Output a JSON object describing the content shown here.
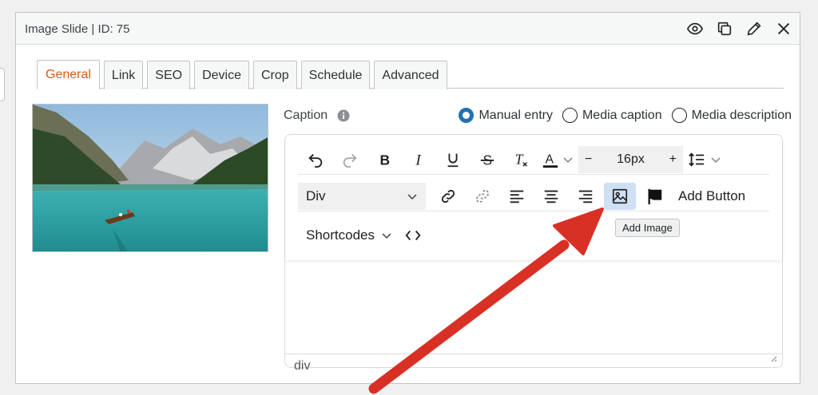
{
  "panel": {
    "title": "Image Slide | ID: 75",
    "header_icons": [
      "eye-icon",
      "duplicate-icon",
      "pencil-icon",
      "close-icon"
    ]
  },
  "tabs": [
    {
      "label": "General",
      "active": true
    },
    {
      "label": "Link"
    },
    {
      "label": "SEO"
    },
    {
      "label": "Device"
    },
    {
      "label": "Crop"
    },
    {
      "label": "Schedule"
    },
    {
      "label": "Advanced"
    }
  ],
  "caption": {
    "label": "Caption",
    "options": [
      {
        "label": "Manual entry",
        "checked": true
      },
      {
        "label": "Media caption",
        "checked": false
      },
      {
        "label": "Media description",
        "checked": false
      }
    ]
  },
  "toolbar": {
    "font_size": "16px",
    "block_format": "Div",
    "add_button_label": "Add Button",
    "shortcodes_label": "Shortcodes",
    "tooltip": "Add Image"
  },
  "editor": {
    "path": "div"
  },
  "colors": {
    "active_tab": "#d35a1a",
    "radio_checked": "#2271b1",
    "highlight": "#cfe0f5",
    "arrow": "#d93025"
  }
}
